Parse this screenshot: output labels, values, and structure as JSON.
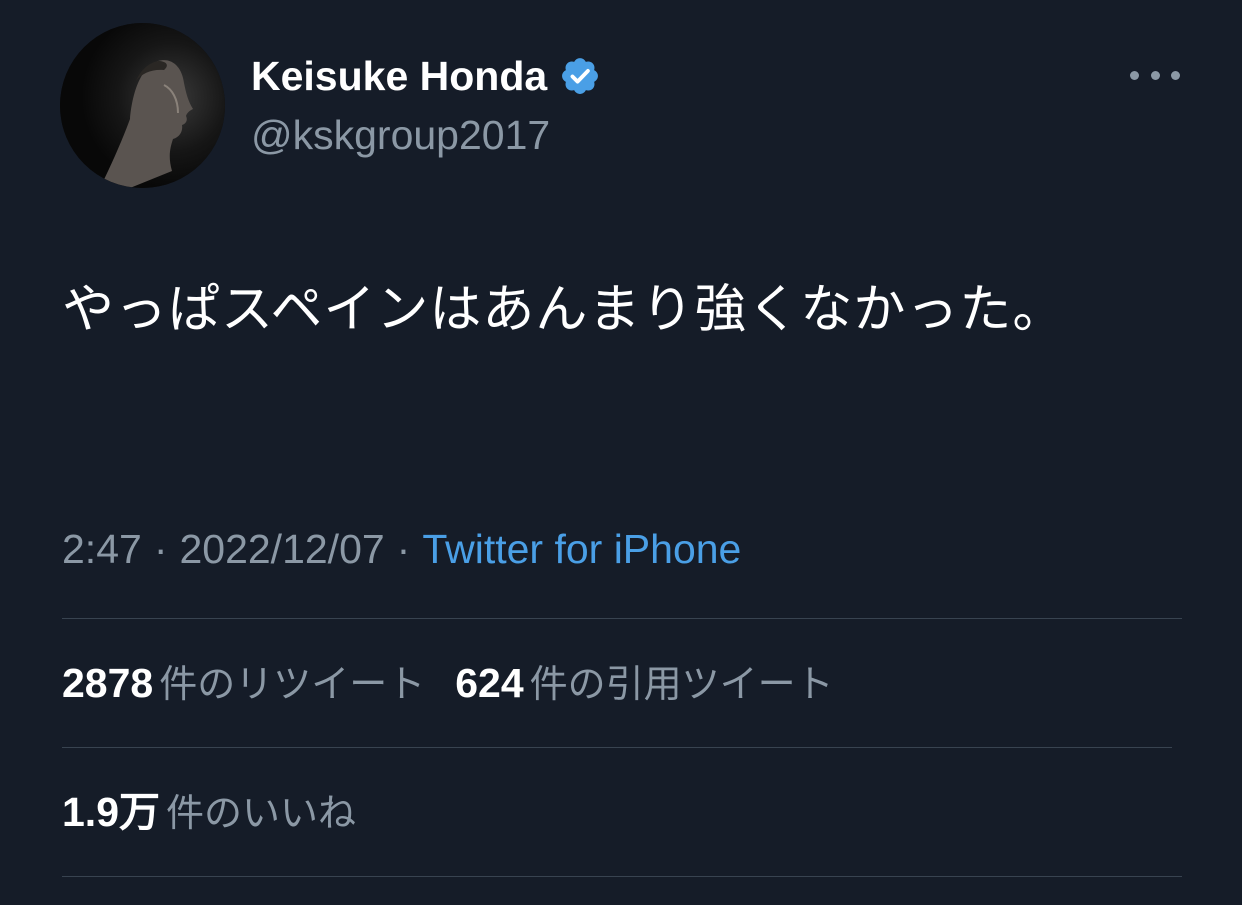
{
  "author": {
    "display_name": "Keisuke Honda",
    "handle": "@kskgroup2017",
    "verified": true
  },
  "tweet": {
    "text": "やっぱスペインはあんまり強くなかった。",
    "time": "2:47",
    "date": "2022/12/07",
    "separator": "·",
    "source": "Twitter for iPhone"
  },
  "stats": {
    "retweets": {
      "count": "2878",
      "label": "件のリツイート"
    },
    "quotes": {
      "count": "624",
      "label": "件の引用ツイート"
    },
    "likes": {
      "count": "1.9万",
      "label": "件のいいね"
    }
  },
  "icons": {
    "verified": "verified-badge-icon",
    "more": "more-options-icon"
  },
  "colors": {
    "background": "#151c28",
    "secondary_text": "#8b98a5",
    "accent": "#4a9fe6",
    "verified_badge": "#4a9fe6",
    "divider": "#384350"
  }
}
